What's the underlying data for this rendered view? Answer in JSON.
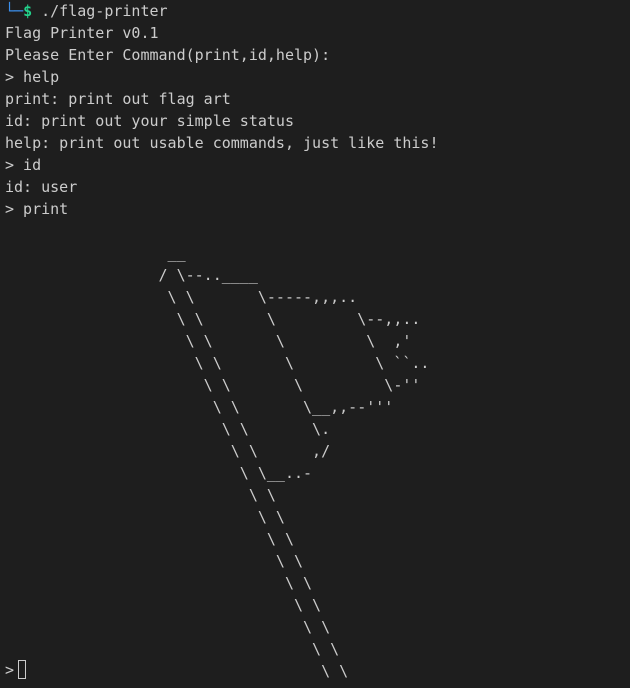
{
  "terminal": {
    "prompt_tree": "└─",
    "prompt_symbol": "$",
    "command": " ./flag-printer",
    "output_lines": [
      "Flag Printer v0.1",
      "Please Enter Command(print,id,help):",
      "> help",
      "print: print out flag art",
      "id: print out your simple status",
      "help: print out usable commands, just like this!",
      "> id",
      "id: user",
      "> print"
    ],
    "flag_art": "\n                  __\n                 / \\--..____\n                  \\ \\       \\-----,,,..\n                   \\ \\       \\         \\--,,..\n                    \\ \\       \\         \\  ,'\n                     \\ \\       \\         \\ ``..\n                      \\ \\       \\         \\-''\n                       \\ \\       \\__,,--'''\n                        \\ \\       \\.\n                         \\ \\      ,/\n                          \\ \\__..-\n                           \\ \\\n                            \\ \\\n                             \\ \\\n                              \\ \\\n                               \\ \\\n                                \\ \\\n                                 \\ \\\n                                  \\ \\\n                                   \\ \\",
    "input_prompt": ">",
    "input_value": ""
  },
  "colors": {
    "background": "#1e1e1e",
    "foreground": "#cccccc",
    "prompt_tree": "#3b8eea",
    "prompt_dollar": "#23d18b"
  }
}
